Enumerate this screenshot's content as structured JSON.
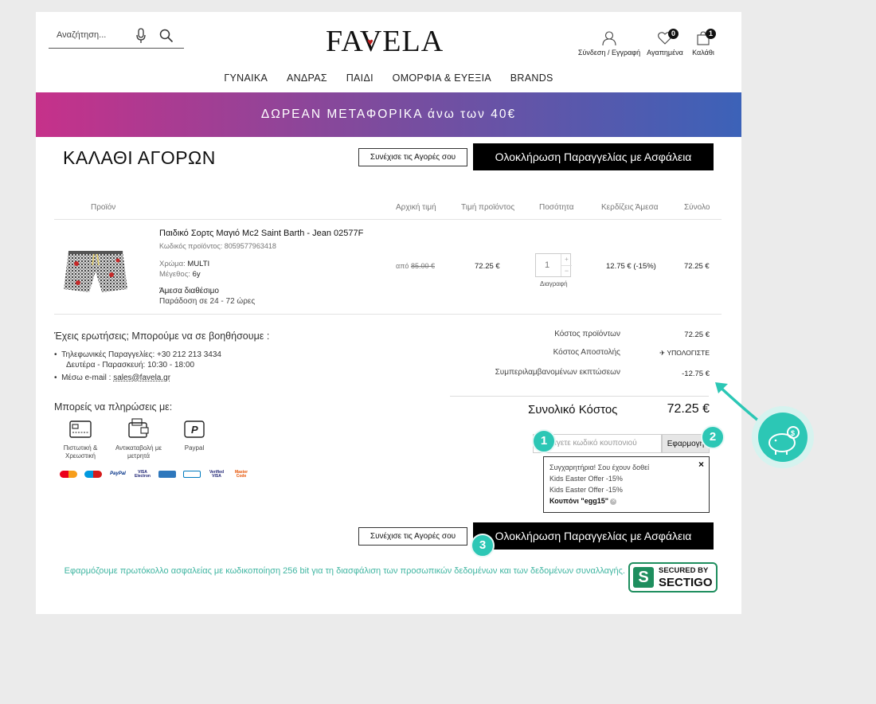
{
  "header": {
    "search_placeholder": "Αναζήτηση...",
    "logo": "FAVELA",
    "account_label": "Σύνδεση / Εγγραφή",
    "wishlist_label": "Αγαπημένα",
    "wishlist_count": "0",
    "cart_label": "Καλάθι",
    "cart_count": "1"
  },
  "nav": [
    "ΓΥΝΑΙΚΑ",
    "ΑΝΔΡΑΣ",
    "ΠΑΙΔΙ",
    "ΟΜΟΡΦΙΑ & ΕΥΕΞΙΑ",
    "BRANDS"
  ],
  "banner": {
    "text_bold": "ΔΩΡΕΑΝ ΜΕΤΑΦΟΡΙΚΑ",
    "text_rest": "άνω των 40€"
  },
  "cart": {
    "title": "ΚΑΛΑΘΙ ΑΓΟΡΩΝ",
    "continue_label": "Συνέχισε τις Αγορές σου",
    "checkout_label": "Ολοκλήρωση Παραγγελίας με Ασφάλεια",
    "columns": [
      "Προϊόν",
      "Αρχική τιμή",
      "Τιμή προϊόντος",
      "Ποσότητα",
      "Κερδίζεις Άμεσα",
      "Σύνολο"
    ],
    "item": {
      "name": "Παιδικό Σορτς Μαγιό Mc2 Saint Barth - Jean 02577F",
      "code": "Κωδικός προϊόντος: 8059577963418",
      "color_label": "Χρώμα:",
      "color_value": "MULTI",
      "size_label": "Μέγεθος:",
      "size_value": "6y",
      "availability": "Άμεσα διαθέσιμο",
      "delivery": "Παράδοση σε 24 - 72 ώρες",
      "original_prefix": "από",
      "original_price": "85.00 €",
      "price": "72.25 €",
      "quantity": "1",
      "delete_label": "Διαγραφή",
      "discount": "12.75 € (-15%)",
      "total": "72.25 €"
    }
  },
  "help": {
    "title": "Έχεις ερωτήσεις; Μπορούμε να σε βοηθήσουμε :",
    "phone_label": "Τηλεφωνικές Παραγγελίες:",
    "phone": "+30 212 213 3434",
    "hours_label": "Δευτέρα - Παρασκευή:",
    "hours": "10:30 - 18:00",
    "email_label": "Μέσω e-mail :",
    "email": "sales@favela.gr"
  },
  "payment": {
    "title": "Μπορείς να πληρώσεις με:",
    "methods": [
      "Πιστωτική & Χρεωστική",
      "Αντικαταβολή με μετρητά",
      "Paypal"
    ],
    "cards": [
      "mastercard",
      "maestro",
      "PayPal",
      "VISA Electron",
      "amex",
      "Diners",
      "Verified by VISA",
      "MasterCard SecureCode"
    ]
  },
  "summary": {
    "products_label": "Κόστος προϊόντων",
    "products_value": "72.25 €",
    "shipping_label": "Κόστος Αποστολής",
    "shipping_value": "ΥΠΟΛΟΓΙΣΤΕ",
    "discounts_label": "Συμπεριλαμβανομένων εκπτώσεων",
    "discounts_value": "-12.75 €",
    "total_label": "Συνολικό Κόστος",
    "total_value": "72.25 €"
  },
  "coupon": {
    "placeholder": "Εισάγετε κωδικό κουπονιού",
    "apply_label": "Εφαρμογή",
    "popup_line1": "Συγχαρητήρια! Σου έχουν δοθεί",
    "popup_line2": "Kids Easter Offer -15%",
    "popup_line3": "Kids Easter Offer -15%",
    "popup_code": "Κουπόνι \"egg15\""
  },
  "steps": [
    "1",
    "2",
    "3"
  ],
  "security": {
    "text": "Εφαρμόζουμε πρωτόκολλο ασφαλείας με κωδικοποίηση 256 bit για τη διασφάλιση των προσωπικών δεδομένων και των δεδομένων συναλλαγής.",
    "badge_line1": "SECURED BY",
    "badge_line2": "SECTIGO"
  },
  "colors": {
    "accent_teal": "#2cc7b5",
    "banner_start": "#c6318a",
    "banner_end": "#3c62b8",
    "security_green": "#3fb5a1"
  }
}
